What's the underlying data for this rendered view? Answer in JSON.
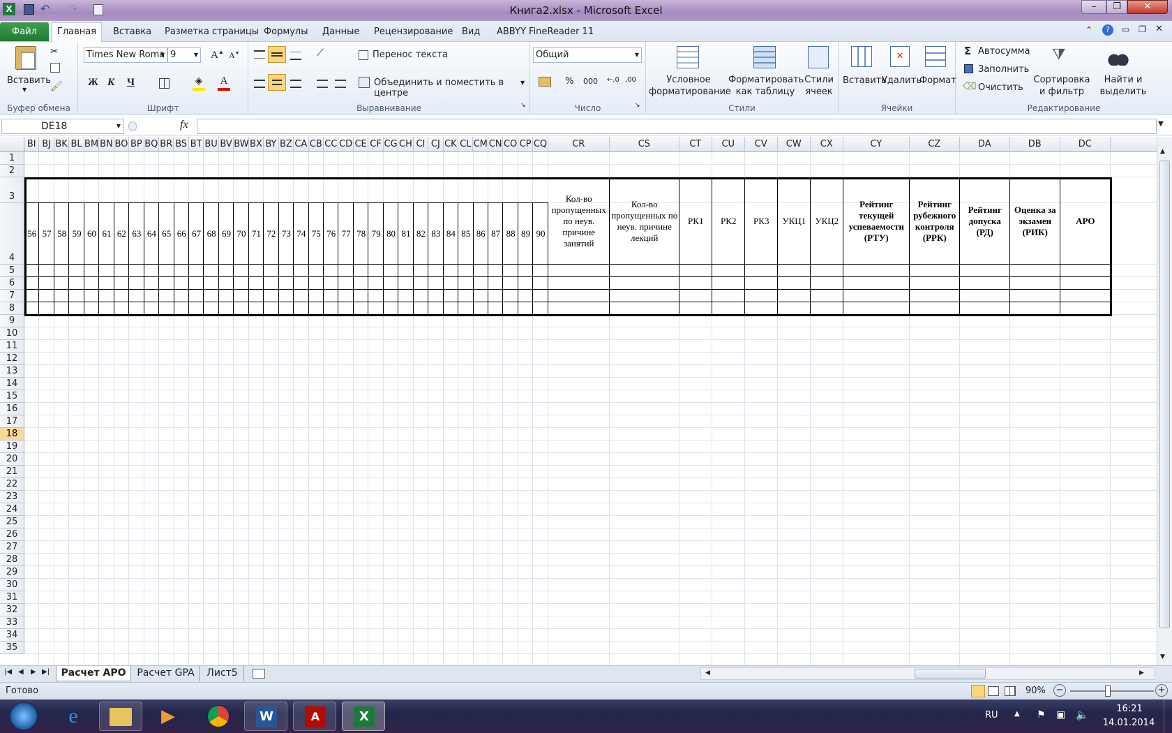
{
  "window": {
    "title": "Книга2.xlsx - Microsoft Excel",
    "app_icon": "excel-icon"
  },
  "ribbon_tabs": [
    "Файл",
    "Главная",
    "Вставка",
    "Разметка страницы",
    "Формулы",
    "Данные",
    "Рецензирование",
    "Вид",
    "ABBYY FineReader 11"
  ],
  "active_tab": "Главная",
  "ribbon": {
    "clipboard": {
      "label": "Буфер обмена",
      "paste": "Вставить"
    },
    "font": {
      "label": "Шрифт",
      "name": "Times New Roma",
      "size": "9",
      "bold": "Ж",
      "italic": "К",
      "underline": "Ч"
    },
    "alignment": {
      "label": "Выравнивание",
      "wrap": "Перенос текста",
      "merge": "Объединить и поместить в центре"
    },
    "number": {
      "label": "Число",
      "format": "Общий",
      "percent": "%",
      "thousands": "000"
    },
    "styles": {
      "label": "Стили",
      "cond1": "Условное",
      "cond2": "форматирование",
      "table1": "Форматировать",
      "table2": "как таблицу",
      "cell1": "Стили",
      "cell2": "ячеек"
    },
    "cells": {
      "label": "Ячейки",
      "insert": "Вставить",
      "delete": "Удалить",
      "format": "Формат"
    },
    "editing": {
      "label": "Редактирование",
      "autosum": "Автосумма",
      "fill": "Заполнить",
      "clear": "Очистить",
      "sort1": "Сортировка",
      "sort2": "и фильтр",
      "find1": "Найти и",
      "find2": "выделить"
    }
  },
  "name_box": "DE18",
  "formula_value": "",
  "columns_narrow": [
    "BI",
    "BJ",
    "BK",
    "BL",
    "BM",
    "BN",
    "BO",
    "BP",
    "BQ",
    "BR",
    "BS",
    "BT",
    "BU",
    "BV",
    "BW",
    "BX",
    "BY",
    "BZ",
    "CA",
    "CB",
    "CC",
    "CD",
    "CE",
    "CF",
    "CG",
    "CH",
    "CI",
    "CJ",
    "CK",
    "CL",
    "CM",
    "CN",
    "CO",
    "CP",
    "CQ"
  ],
  "columns_wide": [
    "CR",
    "CS",
    "CT",
    "CU",
    "CV",
    "CW",
    "CX",
    "CY",
    "CZ",
    "DA",
    "DB",
    "DC"
  ],
  "row_numbers": [
    "1",
    "2",
    "3",
    "4",
    "5",
    "6",
    "7",
    "8",
    "9",
    "10",
    "11",
    "12",
    "13",
    "14",
    "15",
    "16",
    "17",
    "18",
    "19",
    "20",
    "21",
    "22",
    "23",
    "24",
    "25",
    "26",
    "27",
    "28",
    "29",
    "30",
    "31",
    "32",
    "33",
    "34",
    "35"
  ],
  "selected_row": "18",
  "lesson_numbers": [
    "56",
    "57",
    "58",
    "59",
    "60",
    "61",
    "62",
    "63",
    "64",
    "65",
    "66",
    "67",
    "68",
    "69",
    "70",
    "71",
    "72",
    "73",
    "74",
    "75",
    "76",
    "77",
    "78",
    "79",
    "80",
    "81",
    "82",
    "83",
    "84",
    "85",
    "86",
    "87",
    "88",
    "89",
    "90"
  ],
  "headers": [
    {
      "col": "CR",
      "text": "Кол-во пропущенных по неув. причине занятий",
      "bold": false
    },
    {
      "col": "CS",
      "text": "Кол-во пропущенных по неув. причине лекций",
      "bold": false
    },
    {
      "col": "CT",
      "text": "РК1",
      "bold": false
    },
    {
      "col": "CU",
      "text": "РК2",
      "bold": false
    },
    {
      "col": "CV",
      "text": "РК3",
      "bold": false
    },
    {
      "col": "CW",
      "text": "УКЦ1",
      "bold": false
    },
    {
      "col": "CX",
      "text": "УКЦ2",
      "bold": false
    },
    {
      "col": "CY",
      "text": "Рейтинг текущей успеваемости (РТУ)",
      "bold": true
    },
    {
      "col": "CZ",
      "text": "Рейтинг рубежного контроля (РРК)",
      "bold": true
    },
    {
      "col": "DA",
      "text": "Рейтинг допуска (РД)",
      "bold": true
    },
    {
      "col": "DB",
      "text": "Оценка за экзамен (РИК)",
      "bold": true
    },
    {
      "col": "DC",
      "text": "АРО",
      "bold": true
    }
  ],
  "sheet_tabs": [
    "Расчет АРО",
    "Расчет GPA",
    "Лист5"
  ],
  "active_sheet": "Расчет АРО",
  "status": {
    "ready": "Готово",
    "zoom": "90%"
  },
  "taskbar": {
    "lang": "RU",
    "time": "16:21",
    "date": "14.01.2014"
  }
}
